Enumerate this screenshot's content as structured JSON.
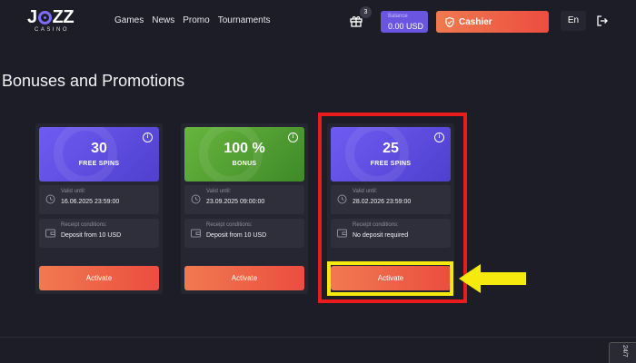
{
  "header": {
    "logo_main_left": "J",
    "logo_main_right": "ZZ",
    "logo_sub": "CASINO",
    "nav": [
      "Games",
      "News",
      "Promo",
      "Tournaments"
    ],
    "gift_count": "3",
    "balance_label": "Balance",
    "balance_value": "0.00 USD",
    "cashier_label": "Cashier",
    "language": "En"
  },
  "page": {
    "title": "Bonuses and Promotions"
  },
  "cards": [
    {
      "amount": "30",
      "type": "FREE SPINS",
      "banner_color": "purple",
      "valid_label": "Valid until:",
      "valid_value": "16.06.2025 23:59:00",
      "receipt_label": "Receipt conditions:",
      "receipt_value": "Deposit from 10 USD",
      "button": "Activate"
    },
    {
      "amount": "100 %",
      "type": "BONUS",
      "banner_color": "green",
      "valid_label": "Valid until:",
      "valid_value": "23.09.2025 09:00:00",
      "receipt_label": "Receipt conditions:",
      "receipt_value": "Deposit from 10 USD",
      "button": "Activate"
    },
    {
      "amount": "25",
      "type": "FREE SPINS",
      "banner_color": "purple",
      "valid_label": "Valid until:",
      "valid_value": "28.02.2026 23:59:00",
      "receipt_label": "Receipt conditions:",
      "receipt_value": "No deposit required",
      "button": "Activate"
    }
  ],
  "chat_tab": "24/7",
  "colors": {
    "background": "#1d1d27",
    "card": "#262632",
    "accent_purple": "#6a55e0",
    "accent_orange": "#ec4d40",
    "highlight_red": "#e81c1c",
    "highlight_yellow": "#f5e90d"
  }
}
